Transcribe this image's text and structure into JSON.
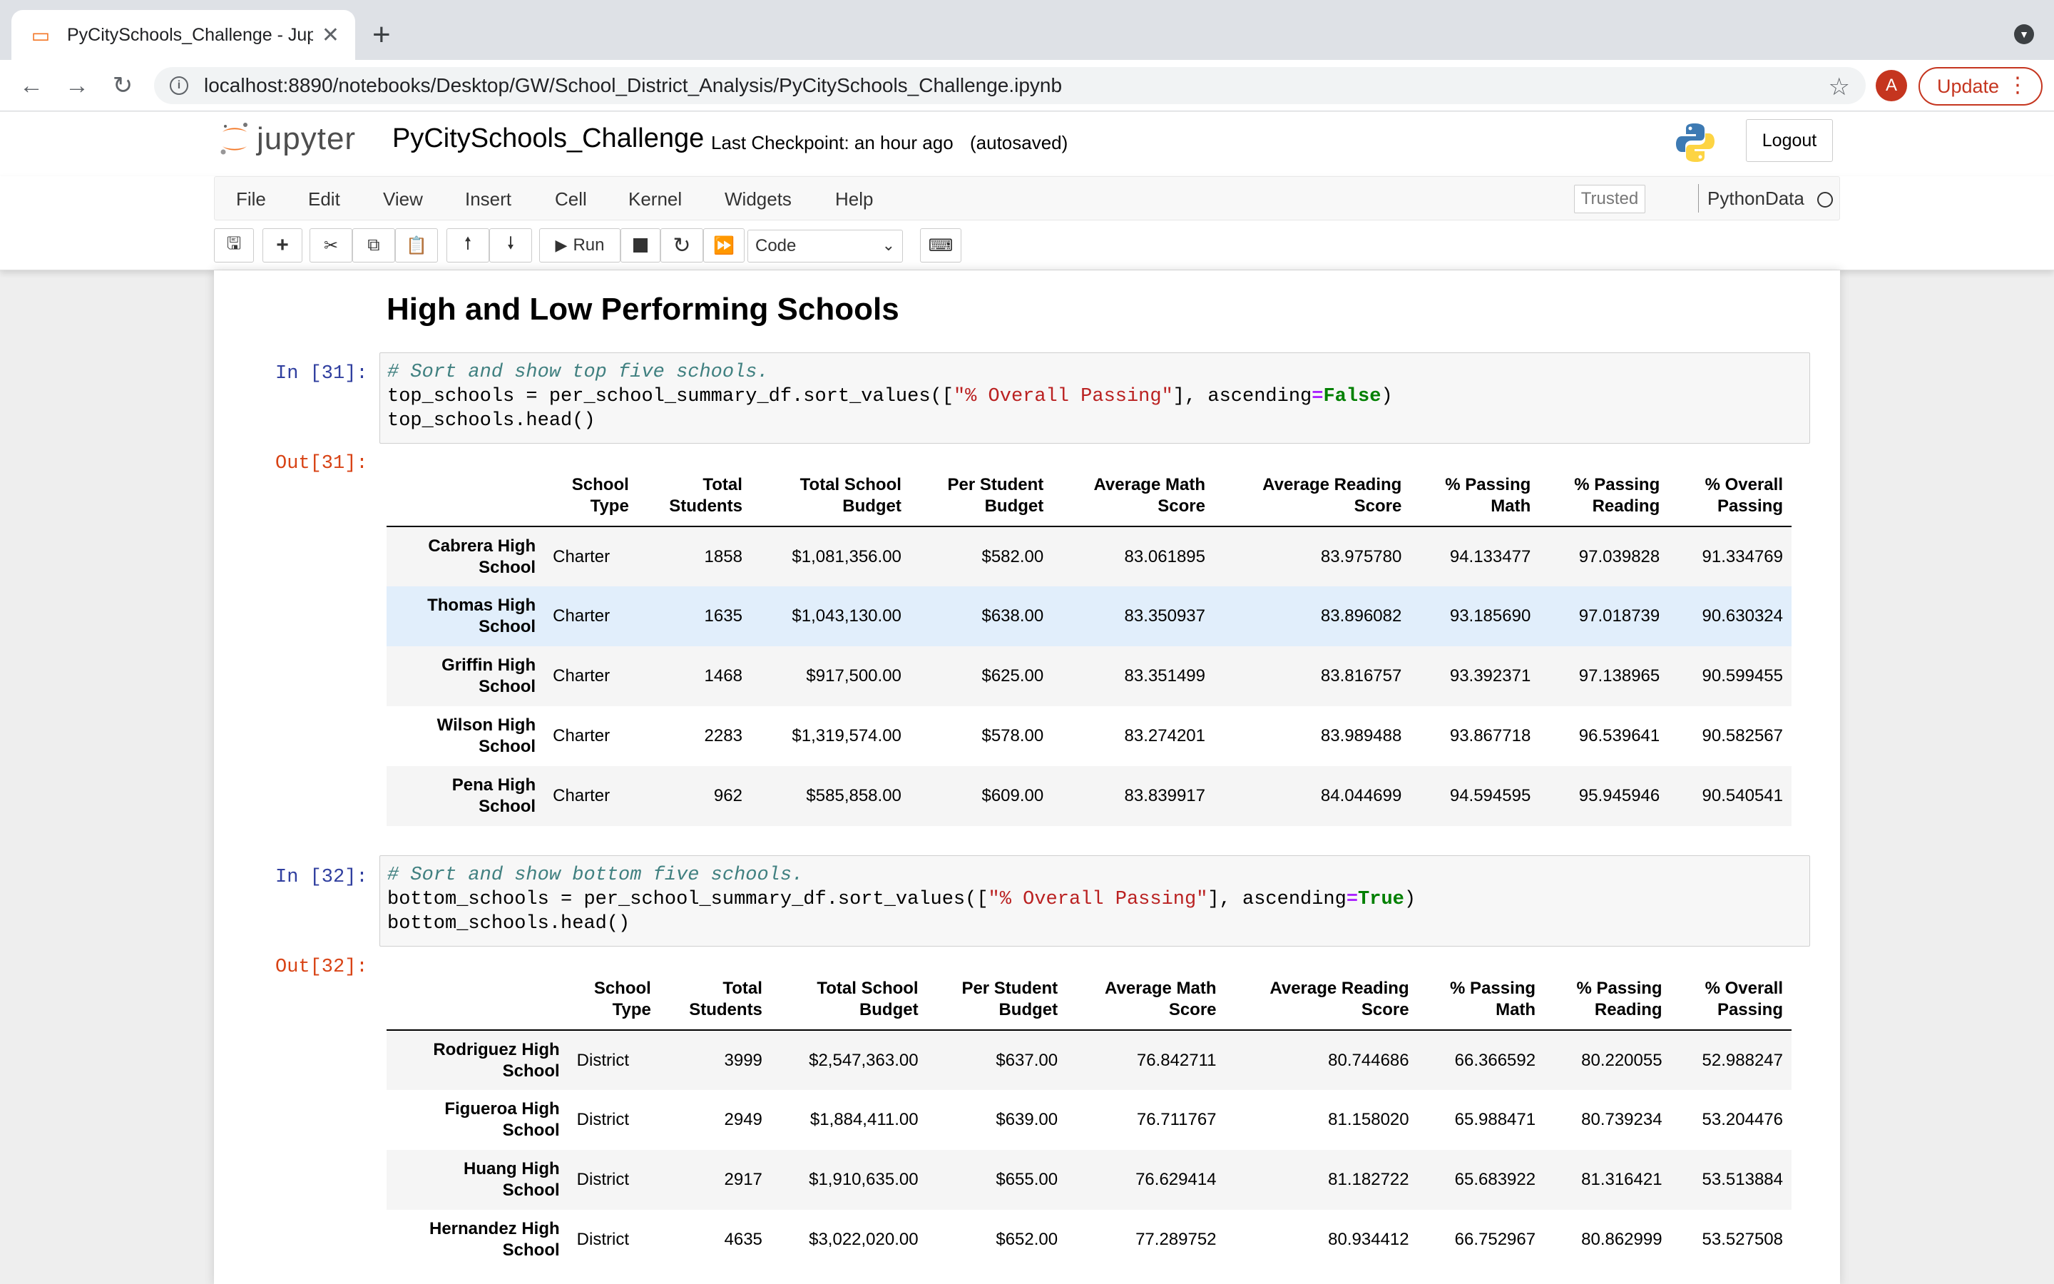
{
  "browser": {
    "tab_title": "PyCitySchools_Challenge - Jup",
    "new_tab": "+",
    "url": "localhost:8890/notebooks/Desktop/GW/School_District_Analysis/PyCitySchools_Challenge.ipynb",
    "avatar_letter": "A",
    "update_label": "Update"
  },
  "jupyter": {
    "logo_text": "jupyter",
    "notebook_name": "PyCitySchools_Challenge",
    "checkpoint": "Last Checkpoint: an hour ago",
    "autosave": "(autosaved)",
    "logout": "Logout",
    "menu": [
      "File",
      "Edit",
      "View",
      "Insert",
      "Cell",
      "Kernel",
      "Widgets",
      "Help"
    ],
    "trusted": "Trusted",
    "kernel": "PythonData",
    "run_label": "Run",
    "cell_type": "Code"
  },
  "notebook": {
    "heading": "High and Low Performing Schools",
    "cell1": {
      "in_prompt": "In [31]:",
      "out_prompt": "Out[31]:",
      "code": {
        "comment": "# Sort and show top five schools.",
        "l2a": "top_schools = per_school_summary_df.sort_values([",
        "l2str": "\"% Overall Passing\"",
        "l2b": "], ascending",
        "l2eq": "=",
        "l2kw": "False",
        "l2c": ")",
        "l3": "top_schools.head()"
      }
    },
    "cell2": {
      "in_prompt": "In [32]:",
      "out_prompt": "Out[32]:",
      "code": {
        "comment": "# Sort and show bottom five schools.",
        "l2a": "bottom_schools = per_school_summary_df.sort_values([",
        "l2str": "\"% Overall Passing\"",
        "l2b": "], ascending",
        "l2eq": "=",
        "l2kw": "True",
        "l2c": ")",
        "l3": "bottom_schools.head()"
      }
    },
    "columns": [
      [
        "School",
        "Type"
      ],
      [
        "Total",
        "Students"
      ],
      [
        "Total School",
        "Budget"
      ],
      [
        "Per Student",
        "Budget"
      ],
      [
        "Average Math",
        "Score"
      ],
      [
        "Average Reading",
        "Score"
      ],
      [
        "% Passing",
        "Math"
      ],
      [
        "% Passing",
        "Reading"
      ],
      [
        "% Overall",
        "Passing"
      ]
    ],
    "top_schools": [
      {
        "name": [
          "Cabrera High",
          "School"
        ],
        "values": [
          "Charter",
          "1858",
          "$1,081,356.00",
          "$582.00",
          "83.061895",
          "83.975780",
          "94.133477",
          "97.039828",
          "91.334769"
        ]
      },
      {
        "name": [
          "Thomas High",
          "School"
        ],
        "values": [
          "Charter",
          "1635",
          "$1,043,130.00",
          "$638.00",
          "83.350937",
          "83.896082",
          "93.185690",
          "97.018739",
          "90.630324"
        ]
      },
      {
        "name": [
          "Griffin High",
          "School"
        ],
        "values": [
          "Charter",
          "1468",
          "$917,500.00",
          "$625.00",
          "83.351499",
          "83.816757",
          "93.392371",
          "97.138965",
          "90.599455"
        ]
      },
      {
        "name": [
          "Wilson High",
          "School"
        ],
        "values": [
          "Charter",
          "2283",
          "$1,319,574.00",
          "$578.00",
          "83.274201",
          "83.989488",
          "93.867718",
          "96.539641",
          "90.582567"
        ]
      },
      {
        "name": [
          "Pena High",
          "School"
        ],
        "values": [
          "Charter",
          "962",
          "$585,858.00",
          "$609.00",
          "83.839917",
          "84.044699",
          "94.594595",
          "95.945946",
          "90.540541"
        ]
      }
    ],
    "bottom_schools": [
      {
        "name": [
          "Rodriguez High",
          "School"
        ],
        "values": [
          "District",
          "3999",
          "$2,547,363.00",
          "$637.00",
          "76.842711",
          "80.744686",
          "66.366592",
          "80.220055",
          "52.988247"
        ]
      },
      {
        "name": [
          "Figueroa High",
          "School"
        ],
        "values": [
          "District",
          "2949",
          "$1,884,411.00",
          "$639.00",
          "76.711767",
          "81.158020",
          "65.988471",
          "80.739234",
          "53.204476"
        ]
      },
      {
        "name": [
          "Huang High",
          "School"
        ],
        "values": [
          "District",
          "2917",
          "$1,910,635.00",
          "$655.00",
          "76.629414",
          "81.182722",
          "65.683922",
          "81.316421",
          "53.513884"
        ]
      },
      {
        "name": [
          "Hernandez High",
          "School"
        ],
        "values": [
          "District",
          "4635",
          "$3,022,020.00",
          "$652.00",
          "77.289752",
          "80.934412",
          "66.752967",
          "80.862999",
          "53.527508"
        ]
      }
    ]
  }
}
